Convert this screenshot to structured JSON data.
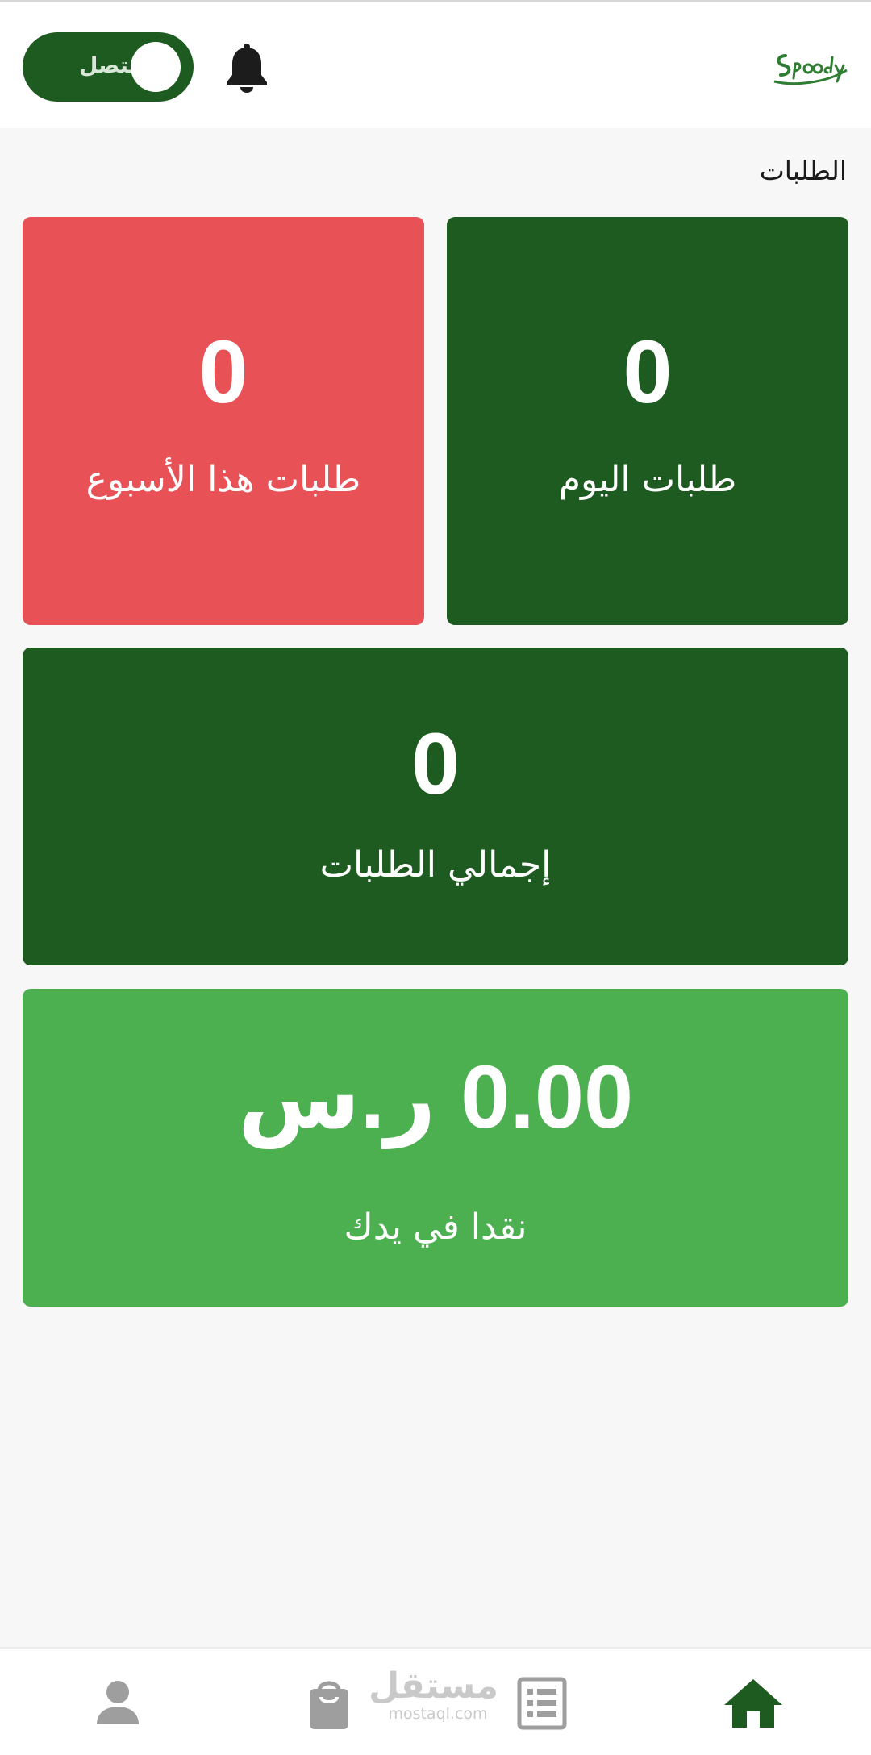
{
  "header": {
    "status_toggle": {
      "label": "متصل",
      "on": true
    },
    "notifications_icon": "bell-icon",
    "logo_icon": "speedy-logo-icon"
  },
  "section_title": "الطلبات",
  "cards": {
    "today": {
      "value": "0",
      "label": "طلبات اليوم",
      "color": "#1e5b20"
    },
    "week": {
      "value": "0",
      "label": "طلبات هذا الأسبوع",
      "color": "#e85155"
    },
    "total": {
      "value": "0",
      "label": "إجمالي الطلبات",
      "color": "#1e5b20"
    },
    "cash": {
      "value": "0.00 ر.س",
      "label": "نقدا في يدك",
      "color": "#4caf50"
    }
  },
  "bottom_nav": {
    "items": [
      {
        "icon": "person-icon"
      },
      {
        "icon": "shopping-bag-icon"
      },
      {
        "icon": "list-icon"
      },
      {
        "icon": "home-icon",
        "active": true
      }
    ],
    "active_color": "#1e5b20",
    "inactive_color": "#9e9e9e"
  },
  "watermark": {
    "arabic": "مستقل",
    "latin": "mostaql.com"
  }
}
